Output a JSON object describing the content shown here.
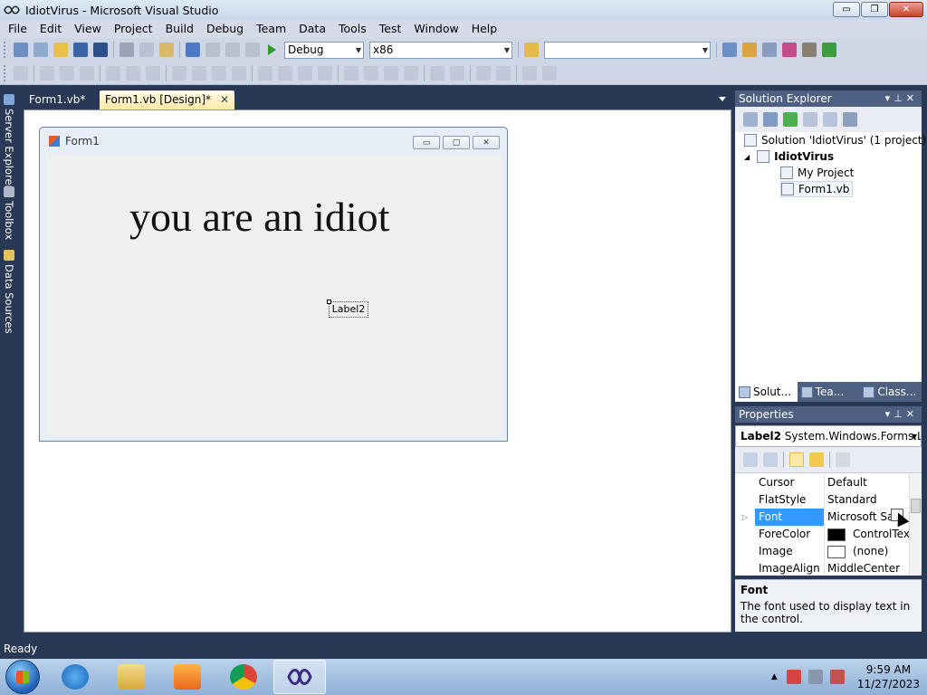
{
  "window": {
    "title": "IdiotVirus - Microsoft Visual Studio",
    "minimize": "▭",
    "maximize": "❐",
    "close": "✕"
  },
  "menu": [
    "File",
    "Edit",
    "View",
    "Project",
    "Build",
    "Debug",
    "Team",
    "Data",
    "Tools",
    "Test",
    "Window",
    "Help"
  ],
  "toolbar": {
    "config": "Debug",
    "platform": "x86",
    "find_value": ""
  },
  "left_tabs": [
    "Server Explorer",
    "Toolbox",
    "Data Sources"
  ],
  "doc_tabs": [
    {
      "label": "Form1.vb*",
      "active": false
    },
    {
      "label": "Form1.vb [Design]*",
      "active": true
    }
  ],
  "form": {
    "title": "Form1",
    "label1": "you are an idiot",
    "label2": "Label2",
    "btn_min": "▭",
    "btn_max": "▢",
    "btn_close": "✕"
  },
  "solution_explorer": {
    "title": "Solution Explorer",
    "solution": "Solution 'IdiotVirus' (1 project)",
    "project": "IdiotVirus",
    "items": [
      "My Project",
      "Form1.vb"
    ],
    "tabs": [
      "Solut...",
      "Tea...",
      "Class..."
    ]
  },
  "properties": {
    "title": "Properties",
    "object_name": "Label2",
    "object_type": "System.Windows.Forms.La",
    "rows": [
      {
        "name": "Cursor",
        "value": "Default"
      },
      {
        "name": "FlatStyle",
        "value": "Standard"
      },
      {
        "name": "Font",
        "value": "Microsoft Sar"
      },
      {
        "name": "ForeColor",
        "value": "ControlTex",
        "swatch": "#000000"
      },
      {
        "name": "Image",
        "value": "(none)",
        "swatch": "#ffffff"
      },
      {
        "name": "ImageAlign",
        "value": "MiddleCenter"
      }
    ],
    "desc_title": "Font",
    "desc_text": "The font used to display text in the control."
  },
  "status": "Ready",
  "taskbar": {
    "time": "9:59 AM",
    "date": "11/27/2023"
  },
  "colors": {
    "ide_background": "#293955",
    "panel_header": "#4d6082",
    "active_tab": "#ffe9a8",
    "selection": "#3399ff"
  }
}
